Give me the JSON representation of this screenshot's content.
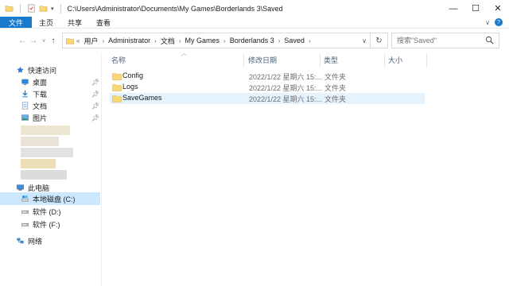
{
  "window": {
    "title_path": "C:\\Users\\Administrator\\Documents\\My Games\\Borderlands 3\\Saved",
    "controls": {
      "minimize": "—",
      "maximize": "☐",
      "close": "✕"
    }
  },
  "ribbon": {
    "tabs": [
      "文件",
      "主页",
      "共享",
      "查看"
    ]
  },
  "address": {
    "back": "←",
    "forward": "→",
    "recent": "∨",
    "up": "↑",
    "lead": "«",
    "crumbs": [
      "用户",
      "Administrator",
      "文档",
      "My Games",
      "Borderlands 3",
      "Saved"
    ],
    "dropdown": "∨",
    "refresh": "↻"
  },
  "search": {
    "placeholder": "搜索\"Saved\""
  },
  "sidebar": {
    "quick_access": "快速访问",
    "pinned": [
      {
        "label": "桌面",
        "icon": "desktop-icon"
      },
      {
        "label": "下载",
        "icon": "download-icon"
      },
      {
        "label": "文档",
        "icon": "documents-icon"
      },
      {
        "label": "图片",
        "icon": "pictures-icon"
      }
    ],
    "this_pc": "此电脑",
    "drives": [
      {
        "label": "本地磁盘 (C:)",
        "selected": true
      },
      {
        "label": "软件 (D:)",
        "selected": false
      },
      {
        "label": "软件 (F:)",
        "selected": false
      }
    ],
    "network": "网络"
  },
  "columns": {
    "name": "名称",
    "date": "修改日期",
    "type": "类型",
    "size": "大小"
  },
  "files": [
    {
      "name": "Config",
      "date": "2022/1/22 星期六 15:...",
      "type": "文件夹",
      "selected": false
    },
    {
      "name": "Logs",
      "date": "2022/1/22 星期六 15:...",
      "type": "文件夹",
      "selected": false
    },
    {
      "name": "SaveGames",
      "date": "2022/1/22 星期六 15:...",
      "type": "文件夹",
      "selected": true
    }
  ],
  "colors": {
    "accent": "#1979ca",
    "selection": "#cce8ff",
    "hover_row": "#e5f3ff",
    "folder": "#f8d775"
  }
}
